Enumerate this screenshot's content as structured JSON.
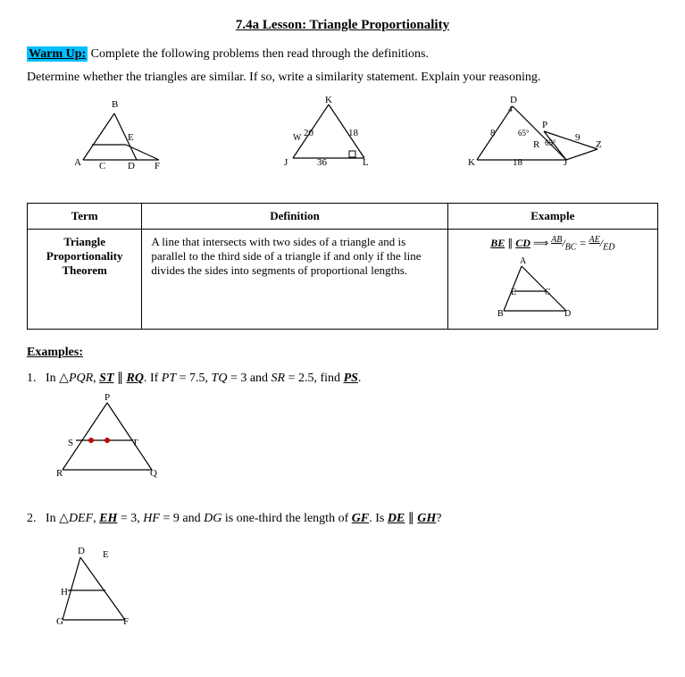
{
  "title": "7.4a Lesson: Triangle Proportionality",
  "warmup_label": "Warm Up:",
  "warmup_text": " Complete the following problems then read through the definitions.",
  "determine_text": "Determine whether the triangles are similar. If so, write a similarity statement. Explain your reasoning.",
  "table": {
    "col1": "Term",
    "col2": "Definition",
    "col3": "Example",
    "term": "Triangle\nProportionality\nTheorem",
    "definition": "A line that intersects with two sides of a triangle and is parallel to the third side of a triangle if and only if the line divides the sides into segments of proportional lengths.",
    "example_formula": "BE ∥ CD  ⟹  AB/BC = AE/ED"
  },
  "examples_label": "Examples:",
  "problem1": {
    "num": "1.",
    "text": "In △PQR, ST ∥ RQ. If PT = 7.5, TQ = 3 and SR = 2.5, find PS."
  },
  "problem2": {
    "num": "2.",
    "text": "In △DEF, EH = 3, HF = 9 and DG is one-third the length of GF. Is DE ∥ GH?"
  }
}
